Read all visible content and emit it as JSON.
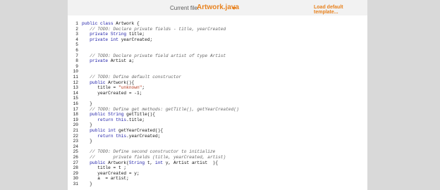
{
  "toolbar": {
    "file_label": "Current file:",
    "file_name": "Artwork.java",
    "load_label": "Load default template..."
  },
  "colors": {
    "accent": "#e8821e",
    "background": "#d9d9d9",
    "panel": "#ffffff"
  },
  "editor": {
    "lines": [
      {
        "n": "1",
        "text": "public class Artwork {"
      },
      {
        "n": "2",
        "text": "   // TODO: Declare private fields - title, yearCreated"
      },
      {
        "n": "3",
        "text": "   private String title;"
      },
      {
        "n": "4",
        "text": "   private int yearCreated;"
      },
      {
        "n": "5",
        "text": ""
      },
      {
        "n": "6",
        "text": ""
      },
      {
        "n": "7",
        "text": "   // TODO: Declare private field artist of type Artist"
      },
      {
        "n": "8",
        "text": "   private Artist a;"
      },
      {
        "n": "9",
        "text": ""
      },
      {
        "n": "10",
        "text": ""
      },
      {
        "n": "11",
        "text": "   // TODO: Define default constructor"
      },
      {
        "n": "12",
        "text": "   public Artwork(){"
      },
      {
        "n": "13",
        "text": "      title = \"unknown\";"
      },
      {
        "n": "14",
        "text": "      yearCreated = -1;"
      },
      {
        "n": "15",
        "text": ""
      },
      {
        "n": "16",
        "text": "   }"
      },
      {
        "n": "17",
        "text": "   // TODO: Define get methods: getTitle(), getYearCreated()"
      },
      {
        "n": "18",
        "text": "   public String getTitle(){"
      },
      {
        "n": "19",
        "text": "      return this.title;"
      },
      {
        "n": "20",
        "text": "   }"
      },
      {
        "n": "21",
        "text": "   public int getYearCreated(){"
      },
      {
        "n": "22",
        "text": "      return this.yearCreated;"
      },
      {
        "n": "23",
        "text": "   }"
      },
      {
        "n": "24",
        "text": ""
      },
      {
        "n": "25",
        "text": "   // TODO: Define second constructor to initialize"
      },
      {
        "n": "26",
        "text": "   //       private fields (title, yearCreated, artist)"
      },
      {
        "n": "27",
        "text": "   public Artwork(String t, int y, Artist artist  ){"
      },
      {
        "n": "28",
        "text": "      title = t ;"
      },
      {
        "n": "29",
        "text": "      yearCreated = y;"
      },
      {
        "n": "30",
        "text": "      a  = artist;"
      },
      {
        "n": "31",
        "text": "   }"
      }
    ]
  }
}
